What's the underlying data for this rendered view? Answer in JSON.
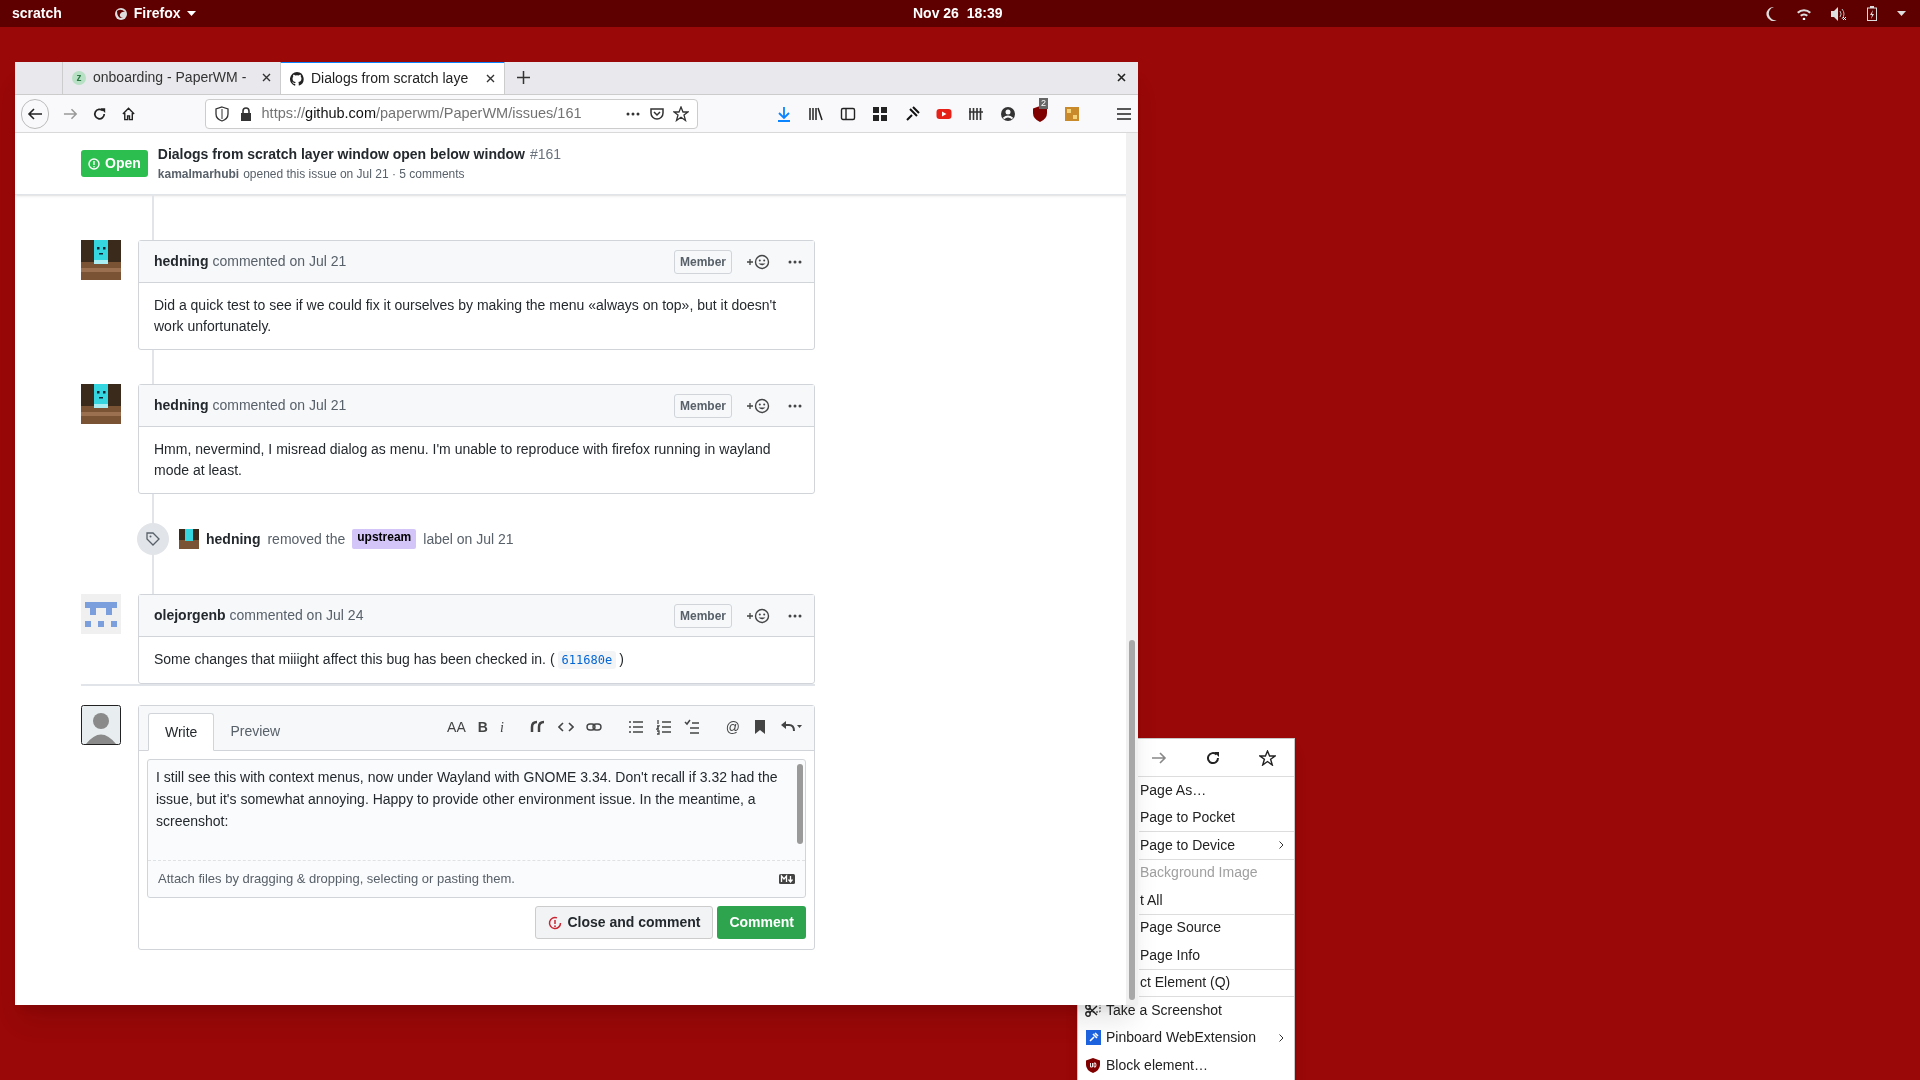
{
  "top_bar": {
    "activities": "scratch",
    "app": "Firefox",
    "clock": "Nov 26  18:39"
  },
  "browser": {
    "tabs": [
      {
        "label": "onboarding - PaperWM -",
        "selected": false,
        "kind": "letter",
        "favicon_text": "z"
      },
      {
        "label": "Dialogs from scratch laye",
        "selected": true,
        "kind": "github"
      }
    ],
    "url": {
      "scheme": "https://",
      "host": "github.com",
      "path": "/paperwm/PaperWM/issues/161"
    },
    "extension_badge": "2"
  },
  "issue": {
    "state": "Open",
    "title": "Dialogs from scratch layer window open below window",
    "number": "#161",
    "author": "kamalmarhubi",
    "meta": "opened this issue on Jul 21 · 5 comments"
  },
  "timeline": [
    {
      "kind": "comment",
      "author": "hedning",
      "action": "commented on Jul 21",
      "role": "Member",
      "body": "Did a quick test to see if we could fix it ourselves by making the menu «always on top», but it doesn't work unfortunately."
    },
    {
      "kind": "comment",
      "author": "hedning",
      "action": "commented on Jul 21",
      "role": "Member",
      "body": "Hmm, nevermind, I misread dialog as menu. I'm unable to reproduce with firefox running in wayland mode at least."
    },
    {
      "kind": "event",
      "author": "hedning",
      "before": "removed the",
      "label": "upstream",
      "after": "label on Jul 21"
    },
    {
      "kind": "comment",
      "author": "olejorgenb",
      "action": "commented on Jul 24",
      "role": "Member",
      "body": "Some changes that miiight affect this bug has been checked in. (",
      "commit": "611680e",
      "body_end": ")"
    }
  ],
  "composer": {
    "tabs": [
      {
        "label": "Write",
        "selected": true
      },
      {
        "label": "Preview",
        "selected": false
      }
    ],
    "format_buttons": [
      {
        "kind": "text",
        "label": "AA"
      },
      {
        "kind": "text",
        "label": "B"
      },
      {
        "kind": "text",
        "label": "i"
      },
      {
        "kind": "quote"
      },
      {
        "kind": "code"
      },
      {
        "kind": "link"
      },
      {
        "kind": "bullets"
      },
      {
        "kind": "numbers"
      },
      {
        "kind": "tasks"
      },
      {
        "kind": "text",
        "label": "@"
      },
      {
        "kind": "bookmark"
      },
      {
        "kind": "reply"
      }
    ],
    "value": "I still see this with context menus, now under Wayland with GNOME 3.34. Don't recall if 3.32 had the issue, but it's somewhat annoying. Happy to provide other environment issue. In the meantime, a screenshot:",
    "attach_hint": "Attach files by dragging & dropping, selecting or pasting them.",
    "close_button": "Close and comment",
    "comment_button": "Comment"
  },
  "context_menu": {
    "items": [
      {
        "kind": "item",
        "label": "Page As…",
        "disabled": false,
        "submenu": false
      },
      {
        "kind": "item",
        "label": "Page to Pocket",
        "disabled": false,
        "submenu": false
      },
      {
        "kind": "item",
        "label": "Page to Device",
        "disabled": false,
        "submenu": true
      },
      {
        "kind": "item",
        "label": "Background Image",
        "disabled": true,
        "submenu": false
      },
      {
        "kind": "item",
        "label": "t All",
        "disabled": false,
        "submenu": false
      },
      {
        "kind": "item",
        "label": "Page Source",
        "disabled": false,
        "submenu": false
      },
      {
        "kind": "item",
        "label": "Page Info",
        "disabled": false,
        "submenu": false
      },
      {
        "kind": "item",
        "label": "ct Element (Q)",
        "disabled": false,
        "submenu": false
      },
      {
        "kind": "screenshot",
        "label": "Take a Screenshot",
        "disabled": false,
        "submenu": false
      },
      {
        "kind": "pinboard",
        "label": "Pinboard WebExtension",
        "disabled": false,
        "submenu": true
      },
      {
        "kind": "blocker",
        "label": "Block element…",
        "disabled": false,
        "submenu": false
      }
    ]
  }
}
